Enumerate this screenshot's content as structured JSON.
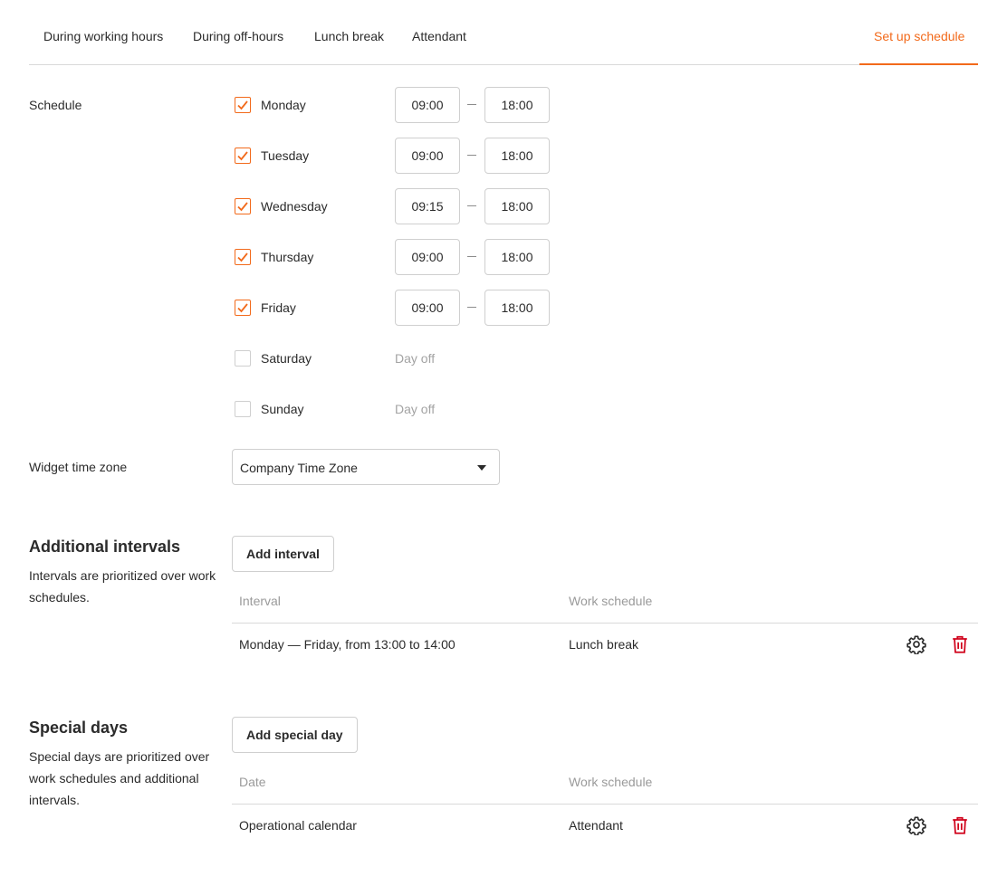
{
  "tabs": [
    {
      "label": "During working hours"
    },
    {
      "label": "During off-hours"
    },
    {
      "label": "Lunch break"
    },
    {
      "label": "Attendant"
    }
  ],
  "setup_tab": {
    "label": "Set up schedule"
  },
  "colors": {
    "accent": "#f26a1b",
    "danger": "#d0021b"
  },
  "schedule": {
    "label": "Schedule",
    "days": [
      {
        "name": "Monday",
        "checked": true,
        "from": "09:00",
        "to": "18:00"
      },
      {
        "name": "Tuesday",
        "checked": true,
        "from": "09:00",
        "to": "18:00"
      },
      {
        "name": "Wednesday",
        "checked": true,
        "from": "09:15",
        "to": "18:00"
      },
      {
        "name": "Thursday",
        "checked": true,
        "from": "09:00",
        "to": "18:00"
      },
      {
        "name": "Friday",
        "checked": true,
        "from": "09:00",
        "to": "18:00"
      },
      {
        "name": "Saturday",
        "checked": false,
        "off_label": "Day off"
      },
      {
        "name": "Sunday",
        "checked": false,
        "off_label": "Day off"
      }
    ]
  },
  "timezone": {
    "label": "Widget time zone",
    "value": "Company Time Zone"
  },
  "intervals": {
    "title": "Additional intervals",
    "description": "Intervals are prioritized over work schedules.",
    "add_button": "Add interval",
    "col_interval": "Interval",
    "col_schedule": "Work schedule",
    "rows": [
      {
        "interval": "Monday — Friday, from 13:00 to 14:00",
        "schedule": "Lunch break",
        "settings_icon": "gear-icon",
        "delete_icon": "trash-icon"
      }
    ]
  },
  "special_days": {
    "title": "Special days",
    "description": "Special days are prioritized over work schedules and additional intervals.",
    "add_button": "Add special day",
    "col_date": "Date",
    "col_schedule": "Work schedule",
    "rows": [
      {
        "date": "Operational calendar",
        "schedule": "Attendant",
        "settings_icon": "gear-icon",
        "delete_icon": "trash-icon"
      }
    ]
  }
}
